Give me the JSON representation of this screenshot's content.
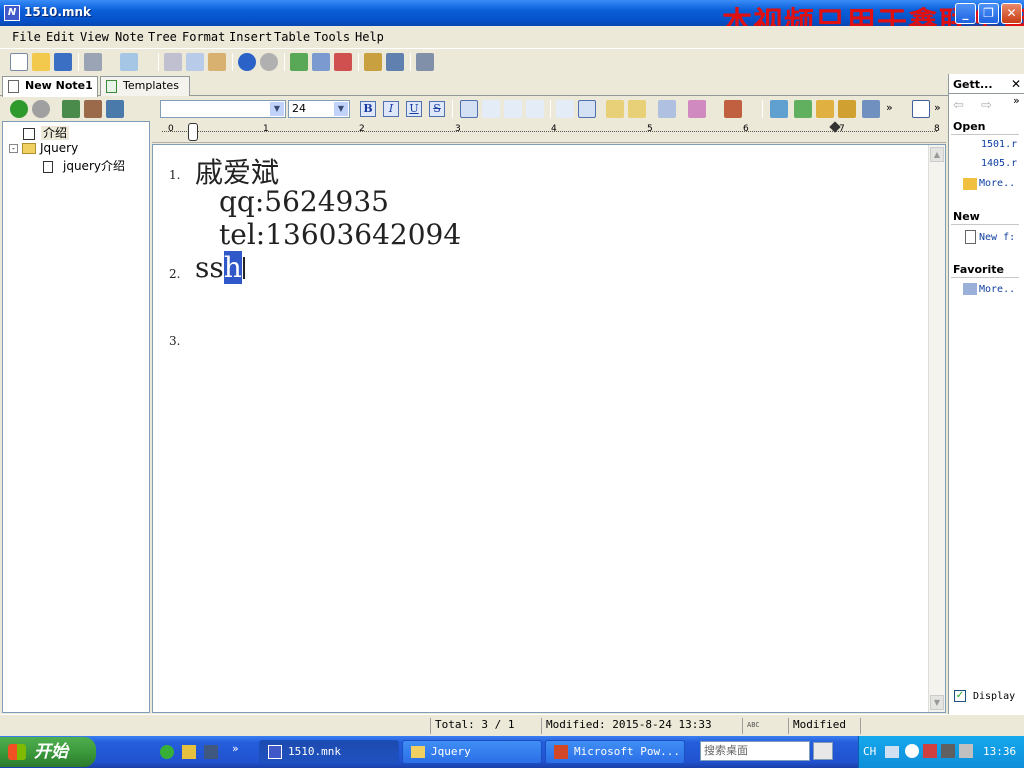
{
  "window": {
    "title": "1510.mnk",
    "watermark": "本视频只用于鑫联华目"
  },
  "menu": [
    "File",
    "Edit",
    "View",
    "Note",
    "Tree",
    "Format",
    "Insert",
    "Table",
    "Tools",
    "Help"
  ],
  "tabs": [
    {
      "label": "New Note1",
      "active": true
    },
    {
      "label": "Templates",
      "active": false
    }
  ],
  "format_bar": {
    "font_name": "",
    "font_size": "24",
    "bold": "B",
    "italic": "I",
    "underline": "U",
    "strike": "S"
  },
  "tree": [
    {
      "label": "介绍",
      "level": 0,
      "selected": true
    },
    {
      "label": "Jquery",
      "level": 0,
      "expanded": true
    },
    {
      "label": "jquery介绍",
      "level": 1
    }
  ],
  "ruler_labels": [
    "0",
    "1",
    "2",
    "3",
    "4",
    "5",
    "6",
    "7",
    "8"
  ],
  "document": {
    "items": [
      {
        "num": "1.",
        "lines": [
          "戚爱斌",
          "qq:5624935",
          "tel:13603642094"
        ]
      },
      {
        "num": "2.",
        "text_before": "ss",
        "selected": "h"
      },
      {
        "num": "3.",
        "text": ""
      }
    ]
  },
  "right_panel": {
    "title": "Gett...",
    "open_header": "Open",
    "open_items": [
      "1501.r",
      "1405.r"
    ],
    "open_more": "More..",
    "new_header": "New",
    "new_item": "New f:",
    "favorite_header": "Favorite",
    "favorite_more": "More..",
    "display_label": "Display"
  },
  "status": {
    "total": "Total: 3 / 1",
    "modified_date": "Modified: 2015-8-24 13:33",
    "spell": "ABC",
    "state": "Modified"
  },
  "taskbar": {
    "start": "开始",
    "tasks": [
      {
        "label": "1510.mnk",
        "active": true
      },
      {
        "label": "Jquery",
        "active": false
      },
      {
        "label": "Microsoft Pow...",
        "active": false
      }
    ],
    "search_placeholder": "搜索桌面",
    "lang": "CH",
    "time": "13:36"
  }
}
